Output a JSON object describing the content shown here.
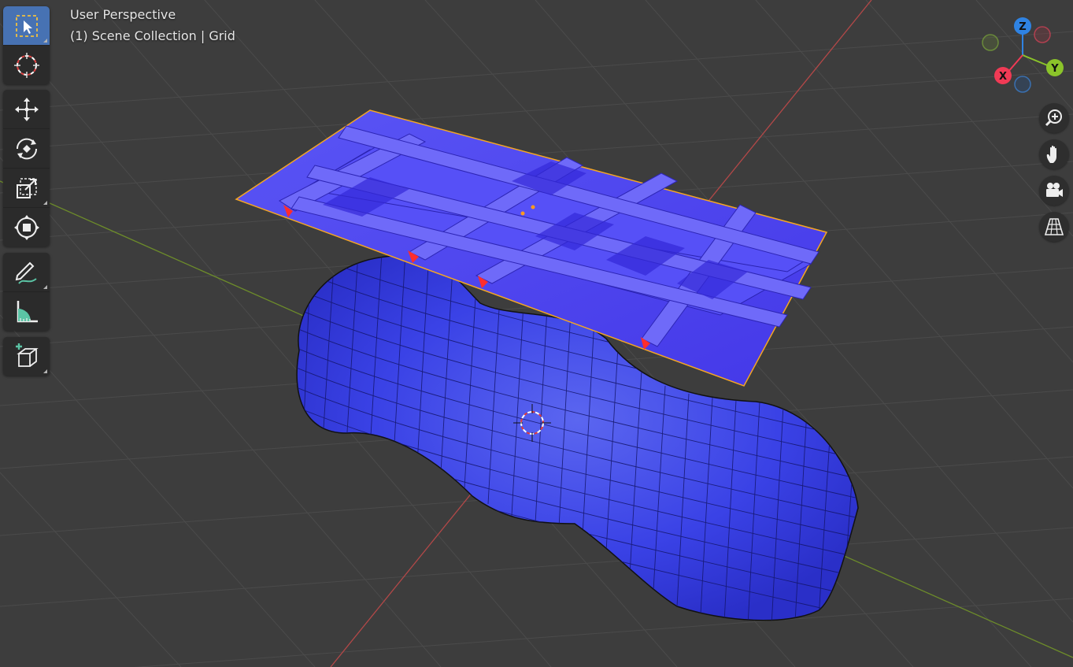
{
  "viewport": {
    "title": "User Perspective",
    "subtitle": "(1) Scene Collection | Grid"
  },
  "toolbar": {
    "tools": [
      {
        "name": "select-box",
        "icon": "select-box-icon",
        "active": true
      },
      {
        "name": "cursor",
        "icon": "cursor-icon"
      },
      {
        "name": "move",
        "icon": "move-icon"
      },
      {
        "name": "rotate",
        "icon": "rotate-icon"
      },
      {
        "name": "scale",
        "icon": "scale-icon"
      },
      {
        "name": "transform",
        "icon": "transform-icon"
      },
      {
        "name": "annotate",
        "icon": "annotate-icon"
      },
      {
        "name": "measure",
        "icon": "measure-icon"
      },
      {
        "name": "add-cube",
        "icon": "add-cube-icon"
      }
    ]
  },
  "gizmo": {
    "axes": [
      {
        "label": "Z",
        "color": "#2f83e3"
      },
      {
        "label": "Y",
        "color": "#8bc42a"
      },
      {
        "label": "X",
        "color": "#f03a55"
      }
    ]
  },
  "nav_buttons": [
    "zoom-icon",
    "hand-icon",
    "camera-icon",
    "grid-icon"
  ],
  "colors": {
    "viewport_bg": "#3d3d3d",
    "grid_line": "#4a4a4a",
    "x_axis": "#b34848",
    "y_axis": "#6d8c2a",
    "mesh_blue": "#3a3ee8",
    "selection_outline": "#f5a623",
    "active_tool": "#4772b3"
  }
}
